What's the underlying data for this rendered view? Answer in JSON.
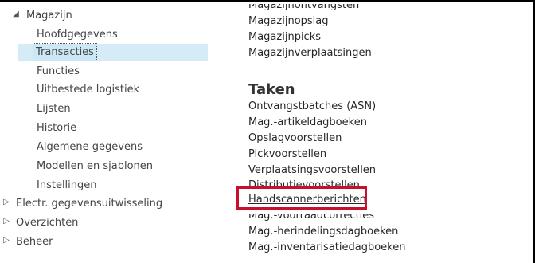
{
  "nav": {
    "items": [
      {
        "label": "Magazijn",
        "level": 0,
        "expander": "expanded"
      },
      {
        "label": "Hoofdgegevens",
        "level": 1
      },
      {
        "label": "Transacties",
        "level": 1,
        "selected": true
      },
      {
        "label": "Functies",
        "level": 1
      },
      {
        "label": "Uitbestede logistiek",
        "level": 1
      },
      {
        "label": "Lijsten",
        "level": 1
      },
      {
        "label": "Historie",
        "level": 1
      },
      {
        "label": "Algemene gegevens",
        "level": 1
      },
      {
        "label": "Modellen en sjablonen",
        "level": 1
      },
      {
        "label": "Instellingen",
        "level": 1
      },
      {
        "label": "Electr. gegevensuitwisseling",
        "level": 0,
        "expander": "collapsed"
      },
      {
        "label": "Overzichten",
        "level": 0,
        "expander": "collapsed"
      },
      {
        "label": "Beheer",
        "level": 0,
        "expander": "collapsed"
      }
    ],
    "expander_glyphs": {
      "expanded": "◢",
      "collapsed": "▷"
    }
  },
  "content": {
    "top_links": [
      {
        "label": "Magazijnontvangsten",
        "partial": true
      },
      {
        "label": "Magazijnopslag"
      },
      {
        "label": "Magazijnpicks"
      },
      {
        "label": "Magazijnverplaatsingen"
      }
    ],
    "section_title": "Taken",
    "task_links": [
      {
        "label": "Ontvangstbatches (ASN)"
      },
      {
        "label": "Mag.-artikeldagboeken"
      },
      {
        "label": "Opslagvoorstellen"
      },
      {
        "label": "Pickvoorstellen"
      },
      {
        "label": "Verplaatsingsvoorstellen"
      },
      {
        "label": "Distributievoorstellen",
        "clipped": true
      },
      {
        "label": "Handscannerberichten",
        "highlighted": true
      },
      {
        "label": "Mag.-voorraadcorrecties",
        "partial": true
      },
      {
        "label": "Mag.-herindelingsdagboeken"
      },
      {
        "label": "Mag.-inventarisatiedagboeken"
      }
    ]
  },
  "colors": {
    "highlight_border": "#c8102e",
    "selection_bg": "#d5ebf8",
    "text": "#262626"
  }
}
